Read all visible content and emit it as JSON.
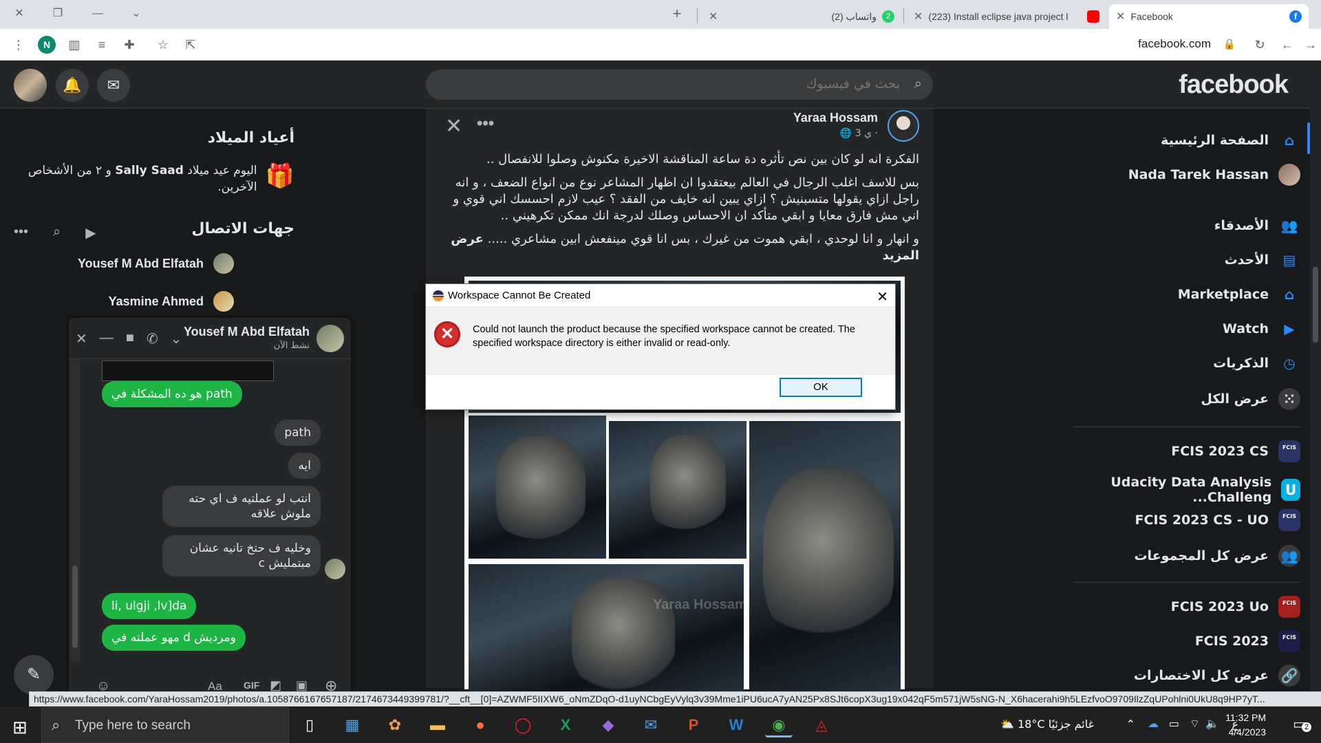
{
  "browser": {
    "tabs": [
      {
        "title": "Facebook",
        "active": true
      },
      {
        "title": "(223) Install eclipse java project l",
        "active": false
      },
      {
        "title": "(2) واتساب",
        "badge": "2",
        "active": false
      }
    ],
    "url": "facebook.com",
    "profile_initial": "N",
    "status_url": "https://www.facebook.com/YaraHossam2019/photos/a.1058766167657187/2174673449399781/?__cft__[0]=AZWMF5IIXW6_oNmZDqO-d1uyNCbgEyVylq3v39Mme1iPU6ucA7yAN25Px8SJt6copX3ug19x042qF5m571jW5sNG-N_X6hacerahi9h5LEzfvoO9709IlzZqUPohlni0UkU8q9HP7yT..."
  },
  "fb": {
    "logo": "facebook",
    "search_placeholder": "بحث في فيسبوك",
    "nav": [
      {
        "label": "الصفحة الرئيسية",
        "icon": "home-icon"
      },
      {
        "label": "Nada Tarek Hassan",
        "icon": "avatar"
      },
      {
        "label": "الأصدقاء",
        "icon": "friends-icon"
      },
      {
        "label": "الأحدث",
        "icon": "feeds-icon"
      },
      {
        "label": "Marketplace",
        "icon": "marketplace-icon"
      },
      {
        "label": "Watch",
        "icon": "watch-icon"
      },
      {
        "label": "الذكريات",
        "icon": "memories-icon"
      },
      {
        "label": "عرض الكل",
        "icon": "grid-icon"
      }
    ],
    "groups": [
      {
        "label": "FCIS 2023 CS"
      },
      {
        "label": "Udacity Data Analysis Challeng..."
      },
      {
        "label": "FCIS 2023 CS - UO"
      },
      {
        "label": "عرض كل المجموعات"
      }
    ],
    "shortcuts": [
      {
        "label": "FCIS 2023 Uo"
      },
      {
        "label": "FCIS 2023"
      },
      {
        "label": "عرض كل الاختصارات"
      }
    ],
    "birthdays": {
      "title": "أعياد الميلاد",
      "text_prefix": "اليوم عيد ميلاد ",
      "name": "Sally Saad",
      "text_suffix": " و ٢ من الأشخاص الآخرين."
    },
    "contacts": {
      "title": "جهات الاتصال",
      "items": [
        {
          "name": "Yousef M Abd Elfatah"
        },
        {
          "name": "Yasmine Ahmed"
        }
      ]
    }
  },
  "chat": {
    "name": "Yousef M Abd Elfatah",
    "status": "نشط الآن",
    "messages": [
      {
        "dir": "out",
        "text": "هو ده المشكلة في path"
      },
      {
        "dir": "in",
        "text": "path"
      },
      {
        "dir": "in",
        "text": "ايه"
      },
      {
        "dir": "in",
        "text": "انتب لو عملتيه ف اي حته ملوش علاقه"
      },
      {
        "dir": "in",
        "text": "وخليه ف حتخ تانيه عشان مبتمليش c"
      },
      {
        "dir": "out",
        "text": "li, ulgji ,lv]da"
      },
      {
        "dir": "out",
        "text": "مهو عملته في d ومرديش"
      }
    ],
    "input_placeholder": "Aa"
  },
  "post": {
    "author": "Yaraa Hossam",
    "time": "3 ي ·",
    "paragraphs": [
      "الفكرة انه لو كان بين نص تأثره دة ساعة المناقشة الاخيرة مكنوش وصلوا للانفصال ..",
      "بس للاسف اغلب الرجال في العالم بيعتقدوا ان اظهار المشاعر نوع من انواع الضعف ، و انه راجل ازاي يقولها متسبنيش ؟ ازاي يبين انه خايف من الفقد ؟ عيب لازم احسسك اني قوي و اني مش فارق معايا و ابقي متأكد ان الاحساس وصلك لدرجة انك ممكن تكرهيني ..",
      "و انهار و انا لوحدي ، ابقي هموت من غيرك ، بس انا قوي مينفعش ابين مشاعري ..... "
    ],
    "see_more": "عرض المزيد",
    "watermark": "Yaraa Hossam"
  },
  "dialog": {
    "title": "Workspace Cannot Be Created",
    "message": "Could not launch the product because the specified workspace cannot be created. The specified workspace directory is either invalid or read-only.",
    "ok_label": "OK"
  },
  "taskbar": {
    "search_placeholder": "Type here to search",
    "weather_temp": "18°C",
    "weather_text": "غائم جزئيًا",
    "lang": "ع",
    "time": "11:32 PM",
    "date": "4/4/2023",
    "notifications": "2"
  }
}
